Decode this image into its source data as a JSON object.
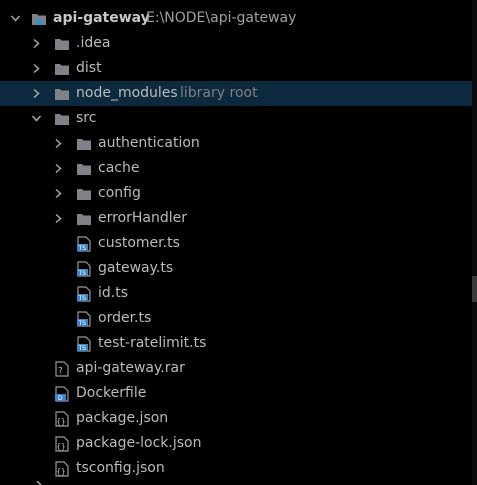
{
  "project": {
    "name": "api-gateway",
    "path": "E:\\NODE\\api-gateway"
  },
  "folders": {
    "idea": ".idea",
    "dist": "dist",
    "node_modules": "node_modules",
    "node_modules_hint": "library root",
    "src": "src"
  },
  "src_folders": {
    "authentication": "authentication",
    "cache": "cache",
    "config": "config",
    "errorHandler": "errorHandler"
  },
  "src_files": [
    "customer.ts",
    "gateway.ts",
    "id.ts",
    "order.ts",
    "test-ratelimit.ts"
  ],
  "root_files": {
    "rar": "api-gateway.rar",
    "dockerfile": "Dockerfile",
    "package": "package.json",
    "package_lock": "package-lock.json",
    "tsconfig": "tsconfig.json"
  },
  "icons": {
    "chevron_expanded": "chevron-down-icon",
    "chevron_collapsed": "chevron-right-icon",
    "folder": "folder-icon",
    "project_folder": "project-folder-icon",
    "typescript_file": "typescript-file-icon",
    "archive_file": "archive-file-icon",
    "docker_file": "dockerfile-icon",
    "json_file": "json-file-icon",
    "ts_badge": "TS",
    "docker_badge": "D"
  },
  "colors": {
    "background": "#000000",
    "selected_row": "#0d293e",
    "text": "#bbbbbb",
    "hint_text": "#808080",
    "folder": "#7f8389",
    "ts_blue": "#3a86c8",
    "project_accent": "#3592c4"
  }
}
